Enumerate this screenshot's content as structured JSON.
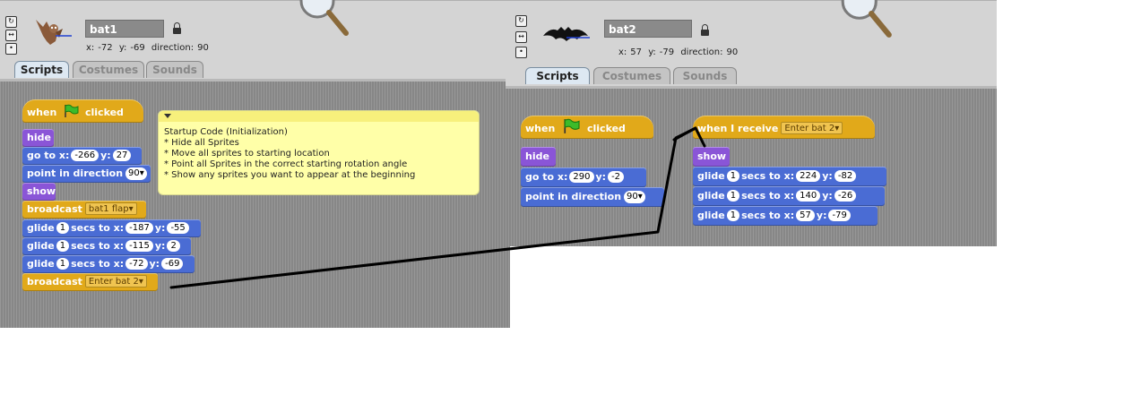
{
  "left_panel": {
    "sprite_name": "bat1",
    "position": {
      "x_label": "x:",
      "x": "-72",
      "y_label": "y:",
      "y": "-69",
      "dir_label": "direction:",
      "direction": "90"
    },
    "tabs": [
      {
        "label": "Scripts"
      },
      {
        "label": "Costumes"
      },
      {
        "label": "Sounds"
      }
    ],
    "script": {
      "hat": {
        "text_before": "when",
        "text_after": "clicked"
      },
      "hide": "hide",
      "goto": {
        "label": "go to x:",
        "x": "-266",
        "y_label": "y:",
        "y": "27"
      },
      "point": {
        "label": "point in direction",
        "value": "90"
      },
      "show": "show",
      "broadcast1": {
        "label": "broadcast",
        "message": "bat1 flap"
      },
      "glide1": {
        "label": "glide",
        "secs": "1",
        "mid": "secs to x:",
        "x": "-187",
        "y_label": "y:",
        "y": "-55"
      },
      "glide2": {
        "label": "glide",
        "secs": "1",
        "mid": "secs to x:",
        "x": "-115",
        "y_label": "y:",
        "y": "2"
      },
      "glide3": {
        "label": "glide",
        "secs": "1",
        "mid": "secs to x:",
        "x": "-72",
        "y_label": "y:",
        "y": "-69"
      },
      "broadcast2": {
        "label": "broadcast",
        "message": "Enter bat 2"
      }
    },
    "comment": {
      "lines": [
        "Startup Code (Initialization)",
        "* Hide all Sprites",
        "* Move all sprites to starting location",
        "* Point all Sprites in the correct starting rotation angle",
        "* Show any sprites you want to appear at the beginning"
      ]
    }
  },
  "right_panel": {
    "sprite_name": "bat2",
    "position": {
      "x_label": "x:",
      "x": "57",
      "y_label": "y:",
      "y": "-79",
      "dir_label": "direction:",
      "direction": "90"
    },
    "tabs": [
      {
        "label": "Scripts"
      },
      {
        "label": "Costumes"
      },
      {
        "label": "Sounds"
      }
    ],
    "script1": {
      "hat": {
        "text_before": "when",
        "text_after": "clicked"
      },
      "hide": "hide",
      "goto": {
        "label": "go to x:",
        "x": "290",
        "y_label": "y:",
        "y": "-2"
      },
      "point": {
        "label": "point in direction",
        "value": "90"
      }
    },
    "script2": {
      "hat": {
        "label": "when I receive",
        "message": "Enter bat 2"
      },
      "show": "show",
      "glide1": {
        "label": "glide",
        "secs": "1",
        "mid": "secs to x:",
        "x": "224",
        "y_label": "y:",
        "y": "-82"
      },
      "glide2": {
        "label": "glide",
        "secs": "1",
        "mid": "secs to x:",
        "x": "140",
        "y_label": "y:",
        "y": "-26"
      },
      "glide3": {
        "label": "glide",
        "secs": "1",
        "mid": "secs to x:",
        "x": "57",
        "y_label": "y:",
        "y": "-79"
      }
    }
  },
  "colors": {
    "motion": "#4a6cd4",
    "looks": "#8a55d7",
    "control": "#e1a91a",
    "annotation_arrow": "#000000"
  },
  "icons": [
    "rotate-icon",
    "flip-icon",
    "no-rotate-icon",
    "lock-icon",
    "magnifier-icon",
    "green-flag-icon",
    "bat-sprite-thumbnail"
  ]
}
